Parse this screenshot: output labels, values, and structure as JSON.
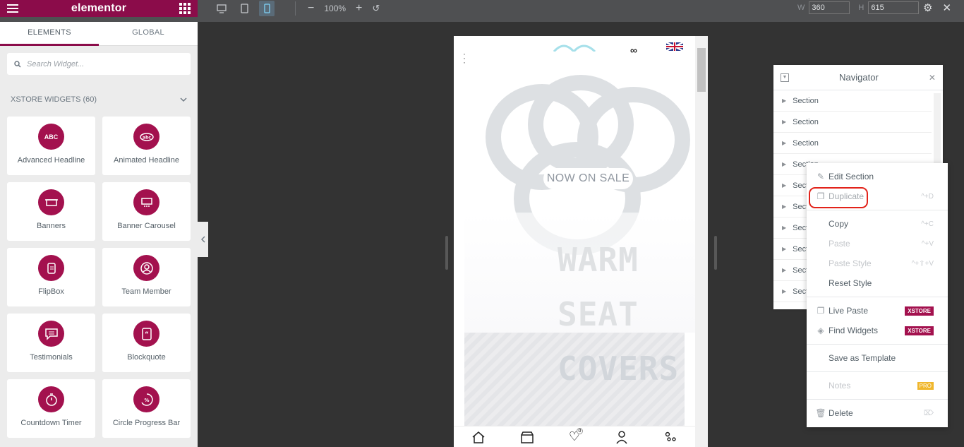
{
  "app": {
    "brand": "elementor"
  },
  "panel": {
    "tabs": [
      {
        "label": "ELEMENTS"
      },
      {
        "label": "GLOBAL"
      }
    ],
    "search_placeholder": "Search Widget...",
    "category": "XSTORE WIDGETS (60)",
    "widgets": [
      {
        "label": "Advanced Headline",
        "icon": "abc-icon"
      },
      {
        "label": "Animated Headline",
        "icon": "animated-headline-icon"
      },
      {
        "label": "Banners",
        "icon": "banner-icon"
      },
      {
        "label": "Banner Carousel",
        "icon": "banner-carousel-icon"
      },
      {
        "label": "FlipBox",
        "icon": "flipbox-icon"
      },
      {
        "label": "Team Member",
        "icon": "team-member-icon"
      },
      {
        "label": "Testimonials",
        "icon": "testimonials-icon"
      },
      {
        "label": "Blockquote",
        "icon": "blockquote-icon"
      },
      {
        "label": "Countdown Timer",
        "icon": "countdown-timer-icon"
      },
      {
        "label": "Circle Progress Bar",
        "icon": "circle-progress-icon"
      }
    ]
  },
  "toolbar": {
    "zoom": "100%",
    "width_label": "W",
    "height_label": "H",
    "width_value": "360",
    "height_value": "615"
  },
  "preview": {
    "sale_label": "NOW ON SALE",
    "line1": "WARM",
    "line2": "SEAT",
    "line3": "COVERS",
    "line3_accent": "S",
    "cart_count": "0"
  },
  "navigator": {
    "title": "Navigator",
    "rows": [
      "Section",
      "Section",
      "Section",
      "Section",
      "Section",
      "Section",
      "Section",
      "Section",
      "Section",
      "Section"
    ]
  },
  "context_menu": {
    "edit": "Edit Section",
    "duplicate": "Duplicate",
    "duplicate_kb": "^+D",
    "copy": "Copy",
    "copy_kb": "^+C",
    "paste": "Paste",
    "paste_kb": "^+V",
    "paste_style": "Paste Style",
    "paste_style_kb": "^+⇧+V",
    "reset_style": "Reset Style",
    "live_paste": "Live Paste",
    "find_widgets": "Find Widgets",
    "xstore_tag": "XSTORE",
    "save_template": "Save as Template",
    "notes": "Notes",
    "pro_tag": "PRO",
    "delete": "Delete"
  },
  "colors": {
    "accent": "#8b0c4a",
    "widget_icon": "#a3114e",
    "highlight": "#e2231a"
  }
}
